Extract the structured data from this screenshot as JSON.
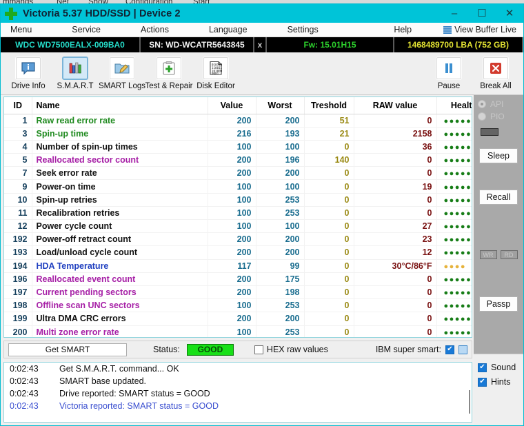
{
  "background_menu": [
    "mmands",
    "Net",
    "Show",
    "Configuration",
    "Start"
  ],
  "window": {
    "title": "Victoria 5.37 HDD/SSD | Device 2",
    "icon": "green-cross-icon",
    "minimize": "–",
    "maximize": "☐",
    "close": "✕"
  },
  "menubar": {
    "items": [
      "Menu",
      "Service",
      "Actions",
      "Language",
      "Settings"
    ],
    "help": "Help",
    "view_buffer": "View Buffer Live"
  },
  "drive_info": {
    "model": "WDC WD7500EALX-009BA0",
    "serial": "SN: WD-WCATR5643845",
    "x": "x",
    "firmware": "Fw: 15.01H15",
    "capacity": "1468489700 LBA (752 GB)"
  },
  "toolbar": {
    "items": [
      {
        "label": "Drive Info",
        "icon": "info-bubble-icon",
        "active": false
      },
      {
        "label": "S.M.A.R.T",
        "icon": "bar-chart-icon",
        "active": true
      },
      {
        "label": "SMART Logs",
        "icon": "folder-pencil-icon",
        "active": false
      },
      {
        "label": "Test & Repair",
        "icon": "clipboard-plus-icon",
        "active": false
      },
      {
        "label": "Disk Editor",
        "icon": "binary-page-icon",
        "active": false
      }
    ],
    "right": [
      {
        "label": "Pause",
        "icon": "pause-icon"
      },
      {
        "label": "Break All",
        "icon": "red-x-icon"
      }
    ]
  },
  "table": {
    "headers": [
      "ID",
      "Name",
      "Value",
      "Worst",
      "Treshold",
      "RAW value",
      "Health"
    ],
    "rows": [
      {
        "id": "1",
        "name": "Raw read error rate",
        "color": "green",
        "value": "200",
        "worst": "200",
        "threshold": "51",
        "raw": "0",
        "health": 5,
        "health_color": "green"
      },
      {
        "id": "3",
        "name": "Spin-up time",
        "color": "green",
        "value": "216",
        "worst": "193",
        "threshold": "21",
        "raw": "2158",
        "health": 5,
        "health_color": "green"
      },
      {
        "id": "4",
        "name": "Number of spin-up times",
        "color": "black",
        "value": "100",
        "worst": "100",
        "threshold": "0",
        "raw": "36",
        "health": 5,
        "health_color": "green"
      },
      {
        "id": "5",
        "name": "Reallocated sector count",
        "color": "purple",
        "value": "200",
        "worst": "196",
        "threshold": "140",
        "raw": "0",
        "health": 5,
        "health_color": "green"
      },
      {
        "id": "7",
        "name": "Seek error rate",
        "color": "black",
        "value": "200",
        "worst": "200",
        "threshold": "0",
        "raw": "0",
        "health": 5,
        "health_color": "green"
      },
      {
        "id": "9",
        "name": "Power-on time",
        "color": "black",
        "value": "100",
        "worst": "100",
        "threshold": "0",
        "raw": "19",
        "health": 5,
        "health_color": "green"
      },
      {
        "id": "10",
        "name": "Spin-up retries",
        "color": "black",
        "value": "100",
        "worst": "253",
        "threshold": "0",
        "raw": "0",
        "health": 5,
        "health_color": "green"
      },
      {
        "id": "11",
        "name": "Recalibration retries",
        "color": "black",
        "value": "100",
        "worst": "253",
        "threshold": "0",
        "raw": "0",
        "health": 5,
        "health_color": "green"
      },
      {
        "id": "12",
        "name": "Power cycle count",
        "color": "black",
        "value": "100",
        "worst": "100",
        "threshold": "0",
        "raw": "27",
        "health": 5,
        "health_color": "green"
      },
      {
        "id": "192",
        "name": "Power-off retract count",
        "color": "black",
        "value": "200",
        "worst": "200",
        "threshold": "0",
        "raw": "23",
        "health": 5,
        "health_color": "green"
      },
      {
        "id": "193",
        "name": "Load/unload cycle count",
        "color": "black",
        "value": "200",
        "worst": "200",
        "threshold": "0",
        "raw": "12",
        "health": 5,
        "health_color": "green"
      },
      {
        "id": "194",
        "name": "HDA Temperature",
        "color": "blue",
        "value": "117",
        "worst": "99",
        "threshold": "0",
        "raw": "30°C/86°F",
        "health": 4,
        "health_color": "orange"
      },
      {
        "id": "196",
        "name": "Reallocated event count",
        "color": "purple",
        "value": "200",
        "worst": "175",
        "threshold": "0",
        "raw": "0",
        "health": 5,
        "health_color": "green"
      },
      {
        "id": "197",
        "name": "Current pending sectors",
        "color": "purple",
        "value": "200",
        "worst": "198",
        "threshold": "0",
        "raw": "0",
        "health": 5,
        "health_color": "green"
      },
      {
        "id": "198",
        "name": "Offline scan UNC sectors",
        "color": "purple",
        "value": "100",
        "worst": "253",
        "threshold": "0",
        "raw": "0",
        "health": 5,
        "health_color": "green"
      },
      {
        "id": "199",
        "name": "Ultra DMA CRC errors",
        "color": "black",
        "value": "200",
        "worst": "200",
        "threshold": "0",
        "raw": "0",
        "health": 5,
        "health_color": "green"
      },
      {
        "id": "200",
        "name": "Multi zone error rate",
        "color": "purple",
        "value": "100",
        "worst": "253",
        "threshold": "0",
        "raw": "0",
        "health": 5,
        "health_color": "green"
      }
    ]
  },
  "status_bar": {
    "get_smart": "Get SMART",
    "status_label": "Status:",
    "status_value": "GOOD",
    "status_color": "#18e018",
    "hex_label": "HEX raw values",
    "hex_checked": false,
    "ibm_label": "IBM super smart:",
    "ibm_checked": true
  },
  "log": {
    "lines": [
      {
        "time": "0:02:43",
        "text": "Get S.M.A.R.T. command... OK",
        "blue": false
      },
      {
        "time": "0:02:43",
        "text": "SMART base updated.",
        "blue": false
      },
      {
        "time": "0:02:43",
        "text": "Drive reported: SMART status = GOOD",
        "blue": false
      },
      {
        "time": "0:02:43",
        "text": "Victoria reported: SMART status = GOOD",
        "blue": true
      }
    ]
  },
  "sidebar": {
    "api_label": "API",
    "pio_label": "PIO",
    "sleep": "Sleep",
    "recall": "Recall",
    "wr": "WR",
    "rd": "RD",
    "passp": "Passp",
    "sound_label": "Sound",
    "sound_checked": true,
    "hints_label": "Hints",
    "hints_checked": true
  }
}
